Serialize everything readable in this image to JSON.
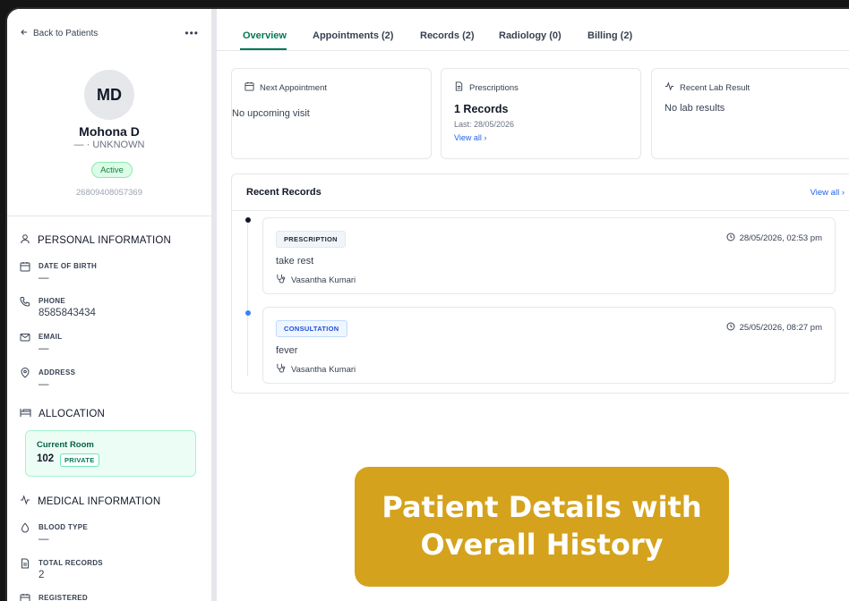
{
  "sidebar": {
    "back_label": "Back to Patients",
    "more_label": "•••",
    "avatar_initials": "MD",
    "patient_name": "Mohona D",
    "patient_sub": "— · UNKNOWN",
    "status": "Active",
    "patient_id": "26809408057369",
    "personal_title": "PERSONAL INFORMATION",
    "fields": [
      {
        "label": "DATE OF BIRTH",
        "value": "—"
      },
      {
        "label": "PHONE",
        "value": "8585843434"
      },
      {
        "label": "EMAIL",
        "value": "—"
      },
      {
        "label": "ADDRESS",
        "value": "—"
      }
    ],
    "allocation_title": "ALLOCATION",
    "room": {
      "label": "Current Room",
      "number": "102",
      "type": "PRIVATE"
    },
    "medical_title": "MEDICAL INFORMATION",
    "medical_fields": [
      {
        "label": "BLOOD TYPE",
        "value": "—"
      },
      {
        "label": "TOTAL RECORDS",
        "value": "2"
      },
      {
        "label": "REGISTERED",
        "value": ""
      }
    ]
  },
  "tabs": [
    {
      "label": "Overview"
    },
    {
      "label": "Appointments (2)"
    },
    {
      "label": "Records (2)"
    },
    {
      "label": "Radiology (0)"
    },
    {
      "label": "Billing (2)"
    }
  ],
  "summary_cards": {
    "next_appointment": {
      "title": "Next Appointment",
      "value": "No upcoming visit"
    },
    "prescriptions": {
      "title": "Prescriptions",
      "count": "1 Records",
      "last": "Last: 28/05/2026",
      "link": "View all ›"
    },
    "lab": {
      "title": "Recent Lab Result",
      "value": "No lab results"
    }
  },
  "recent_records": {
    "title": "Recent Records",
    "view_all": "View all ›",
    "items": [
      {
        "type": "PRESCRIPTION",
        "date": "28/05/2026, 02:53 pm",
        "note": "take rest",
        "doctor": "Vasantha Kumari"
      },
      {
        "type": "CONSULTATION",
        "date": "25/05/2026, 08:27 pm",
        "note": "fever",
        "doctor": "Vasantha Kumari"
      }
    ]
  },
  "promo": {
    "line1": "Patient Details with",
    "line2": "Overall History"
  },
  "colors": {
    "accent": "#047857",
    "link": "#2563eb",
    "promo": "#d4a21c"
  }
}
